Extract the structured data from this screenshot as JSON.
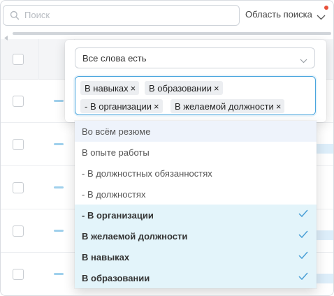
{
  "search": {
    "placeholder": "Поиск"
  },
  "scope": {
    "label": "Область поиска"
  },
  "filter": {
    "mode_value": "Все слова есть",
    "tags": [
      {
        "label": "В навыках"
      },
      {
        "label": "В образовании"
      },
      {
        "label": "- В организации"
      },
      {
        "label": "В желаемой должности"
      }
    ],
    "options": [
      {
        "label": "Во всём резюме",
        "selected": false
      },
      {
        "label": "В опыте работы",
        "selected": false
      },
      {
        "label": "- В должностных обязанностях",
        "selected": false
      },
      {
        "label": "- В должностях",
        "selected": false
      },
      {
        "label": "- В организации",
        "selected": true
      },
      {
        "label": "В желаемой должности",
        "selected": true
      },
      {
        "label": "В навыках",
        "selected": true
      },
      {
        "label": "В образовании",
        "selected": true
      }
    ]
  },
  "icons": {
    "search": "magnifier-icon",
    "scope_chevron": "chevron-down-icon",
    "tag_remove": "×",
    "check": "check-icon",
    "notification": "notification-dot"
  },
  "colors": {
    "accent": "#4aa6de",
    "selected_bg": "#e3f4fa",
    "hover_bg": "#eef3fb",
    "notification": "#e8513a",
    "check": "#4a9fd6"
  }
}
